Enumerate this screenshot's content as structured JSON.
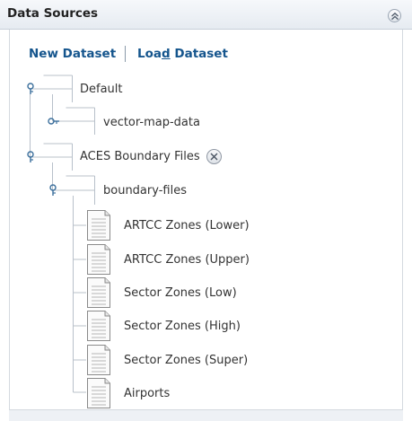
{
  "panel": {
    "title": "Data Sources"
  },
  "actions": {
    "new_dataset": "New Dataset",
    "load_dataset_pre": "Loa",
    "load_dataset_u": "d",
    "load_dataset_post": " Dataset"
  },
  "tree": {
    "default": "Default",
    "vector_map_data": "vector-map-data",
    "aces_boundary_files": "ACES Boundary Files",
    "boundary_files": "boundary-files",
    "files": [
      "ARTCC Zones (Lower)",
      "ARTCC Zones (Upper)",
      "Sector Zones (Low)",
      "Sector Zones (High)",
      "Sector Zones (Super)",
      "Airports"
    ]
  },
  "icons": {
    "collapse": "double-chevron-up-icon",
    "key": "key-icon",
    "remove": "remove-x-icon",
    "document": "document-icon"
  },
  "colors": {
    "link": "#15558d",
    "tree_line": "#b8c0ca",
    "header_bg": "#e9edf2"
  }
}
